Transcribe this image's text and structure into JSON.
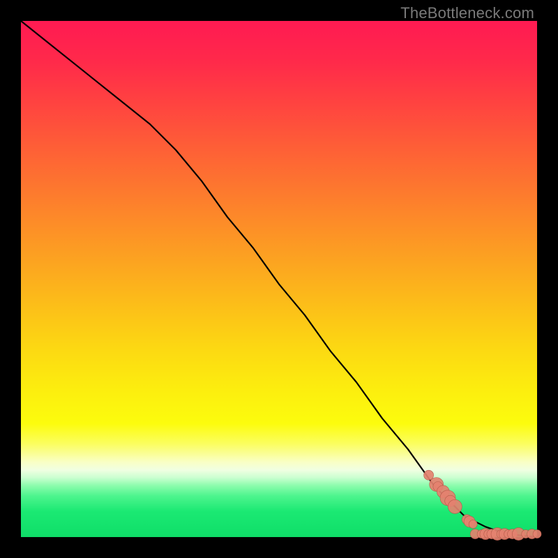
{
  "watermark": "TheBottleneck.com",
  "colors": {
    "line": "#000000",
    "marker_fill": "#e4816f",
    "marker_stroke": "#b65a4a"
  },
  "chart_data": {
    "type": "line",
    "title": "",
    "xlabel": "",
    "ylabel": "",
    "xlim": [
      0,
      100
    ],
    "ylim": [
      0,
      100
    ],
    "grid": false,
    "legend": false,
    "series": [
      {
        "name": "curve",
        "kind": "line",
        "x": [
          0,
          5,
          10,
          15,
          20,
          25,
          30,
          35,
          40,
          45,
          50,
          55,
          60,
          65,
          70,
          75,
          80,
          82,
          84,
          86,
          88,
          90,
          92,
          94,
          96,
          98,
          100
        ],
        "y": [
          100,
          96,
          92,
          88,
          84,
          80,
          75,
          69,
          62,
          56,
          49,
          43,
          36,
          30,
          23,
          17,
          10,
          8,
          6,
          4,
          3,
          2,
          1.3,
          0.8,
          0.4,
          0.2,
          0
        ]
      },
      {
        "name": "markers-descending",
        "kind": "scatter",
        "x": [
          79,
          80.5,
          80.8,
          81.8,
          82.7,
          83.2,
          84.1,
          86.4,
          86.9,
          87.6
        ],
        "y": [
          12.0,
          10.2,
          9.8,
          8.8,
          7.6,
          7.0,
          5.9,
          3.4,
          3.0,
          2.5
        ],
        "sizes": [
          7,
          10,
          7,
          9,
          11,
          8,
          10,
          7,
          8,
          6
        ]
      },
      {
        "name": "markers-floor",
        "kind": "scatter",
        "x": [
          88,
          89.2,
          90.0,
          90.5,
          91.2,
          92.3,
          93.0,
          93.7,
          94.4,
          95.2,
          96.4,
          97.8,
          99.0,
          100
        ],
        "y": [
          0.6,
          0.6,
          0.6,
          0.6,
          0.6,
          0.6,
          0.6,
          0.6,
          0.6,
          0.6,
          0.6,
          0.6,
          0.6,
          0.6
        ],
        "sizes": [
          7,
          6,
          8,
          6,
          7,
          9,
          6,
          8,
          6,
          7,
          9,
          6,
          7,
          6
        ]
      }
    ]
  }
}
